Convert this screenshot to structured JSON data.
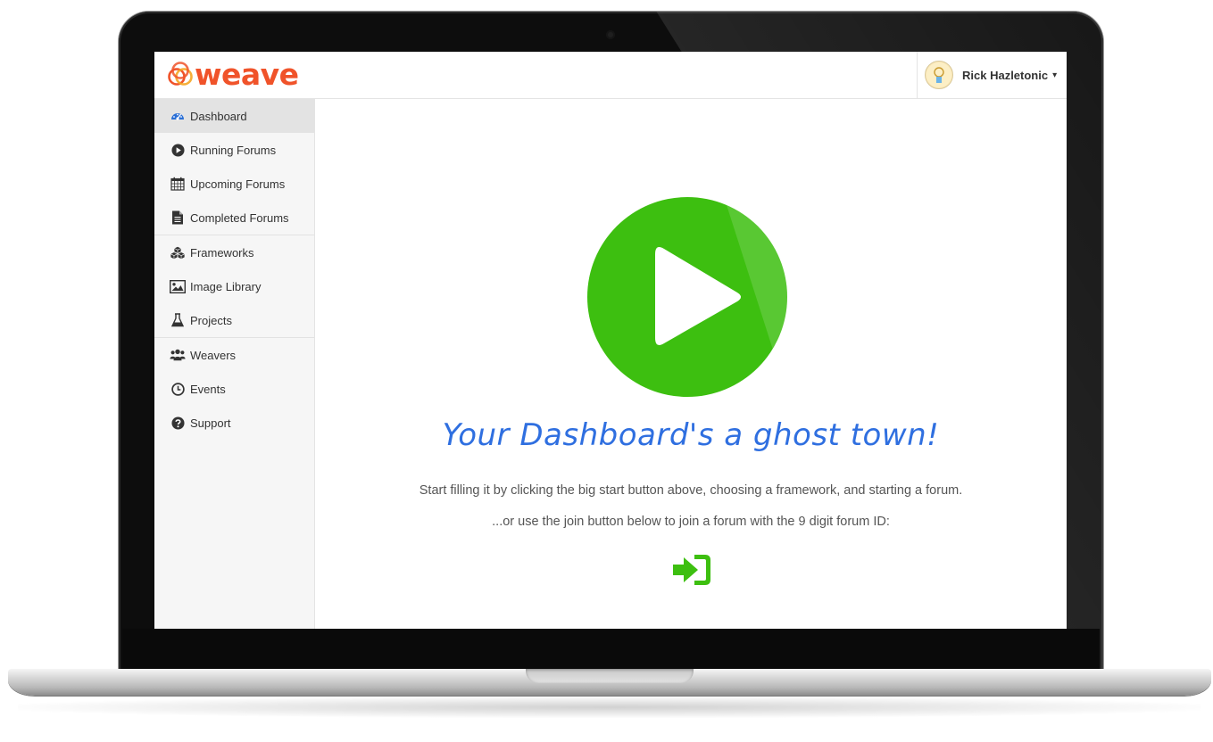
{
  "app": {
    "name": "weave",
    "brand_color": "#f0532a",
    "accent_color": "#3dbf10",
    "headline_color": "#2f6fe0"
  },
  "user": {
    "name": "Rick Hazletonic",
    "caret": "▾"
  },
  "sidebar": {
    "groups": [
      {
        "items": [
          {
            "label": "Dashboard",
            "icon": "dashboard-icon",
            "active": true
          },
          {
            "label": "Running Forums",
            "icon": "play-circle-icon"
          },
          {
            "label": "Upcoming Forums",
            "icon": "calendar-icon"
          },
          {
            "label": "Completed Forums",
            "icon": "document-icon"
          }
        ]
      },
      {
        "items": [
          {
            "label": "Frameworks",
            "icon": "cubes-icon"
          },
          {
            "label": "Image Library",
            "icon": "image-icon"
          },
          {
            "label": "Projects",
            "icon": "flask-icon"
          }
        ]
      },
      {
        "items": [
          {
            "label": "Weavers",
            "icon": "users-icon"
          },
          {
            "label": "Events",
            "icon": "clock-icon"
          },
          {
            "label": "Support",
            "icon": "question-circle-icon"
          }
        ]
      }
    ]
  },
  "main": {
    "start_button_icon": "play-icon",
    "headline": "Your Dashboard's a ghost town!",
    "description": "Start filling it by clicking the big start button above, choosing a framework, and starting a forum.",
    "join_hint": "...or use the join button below to join a forum with the 9 digit forum ID:",
    "join_button_icon": "sign-in-icon"
  }
}
